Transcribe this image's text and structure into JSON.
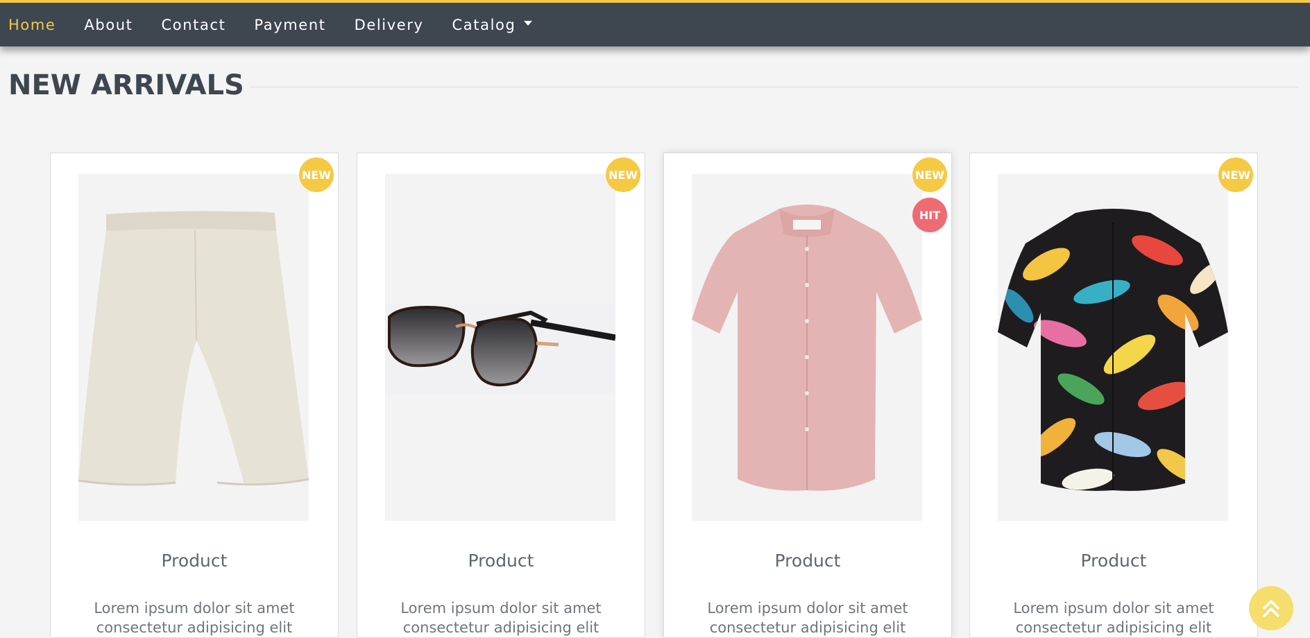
{
  "nav": {
    "items": [
      {
        "label": "Home",
        "active": true
      },
      {
        "label": "About"
      },
      {
        "label": "Contact"
      },
      {
        "label": "Payment"
      },
      {
        "label": "Delivery"
      },
      {
        "label": "Catalog",
        "dropdown": true
      }
    ]
  },
  "section": {
    "title": "NEW ARRIVALS"
  },
  "products": [
    {
      "name": "Product",
      "desc": "Lorem ipsum dolor sit amet consectetur adipisicing elit",
      "badges": [
        "NEW"
      ],
      "image": "beige-shorts"
    },
    {
      "name": "Product",
      "desc": "Lorem ipsum dolor sit amet consectetur adipisicing elit",
      "badges": [
        "NEW"
      ],
      "image": "sunglasses"
    },
    {
      "name": "Product",
      "desc": "Lorem ipsum dolor sit amet consectetur adipisicing elit",
      "badges": [
        "NEW",
        "HIT"
      ],
      "image": "pink-shirt"
    },
    {
      "name": "Product",
      "desc": "Lorem ipsum dolor sit amet consectetur adipisicing elit",
      "badges": [
        "NEW"
      ],
      "image": "floral-shirt"
    }
  ],
  "colors": {
    "accent": "#f6c945",
    "navbar": "#3e4650",
    "hit_badge": "#ee6b73",
    "background": "#f4f4f4"
  },
  "icons": {
    "scroll_top": "double-chevron-up-icon"
  }
}
